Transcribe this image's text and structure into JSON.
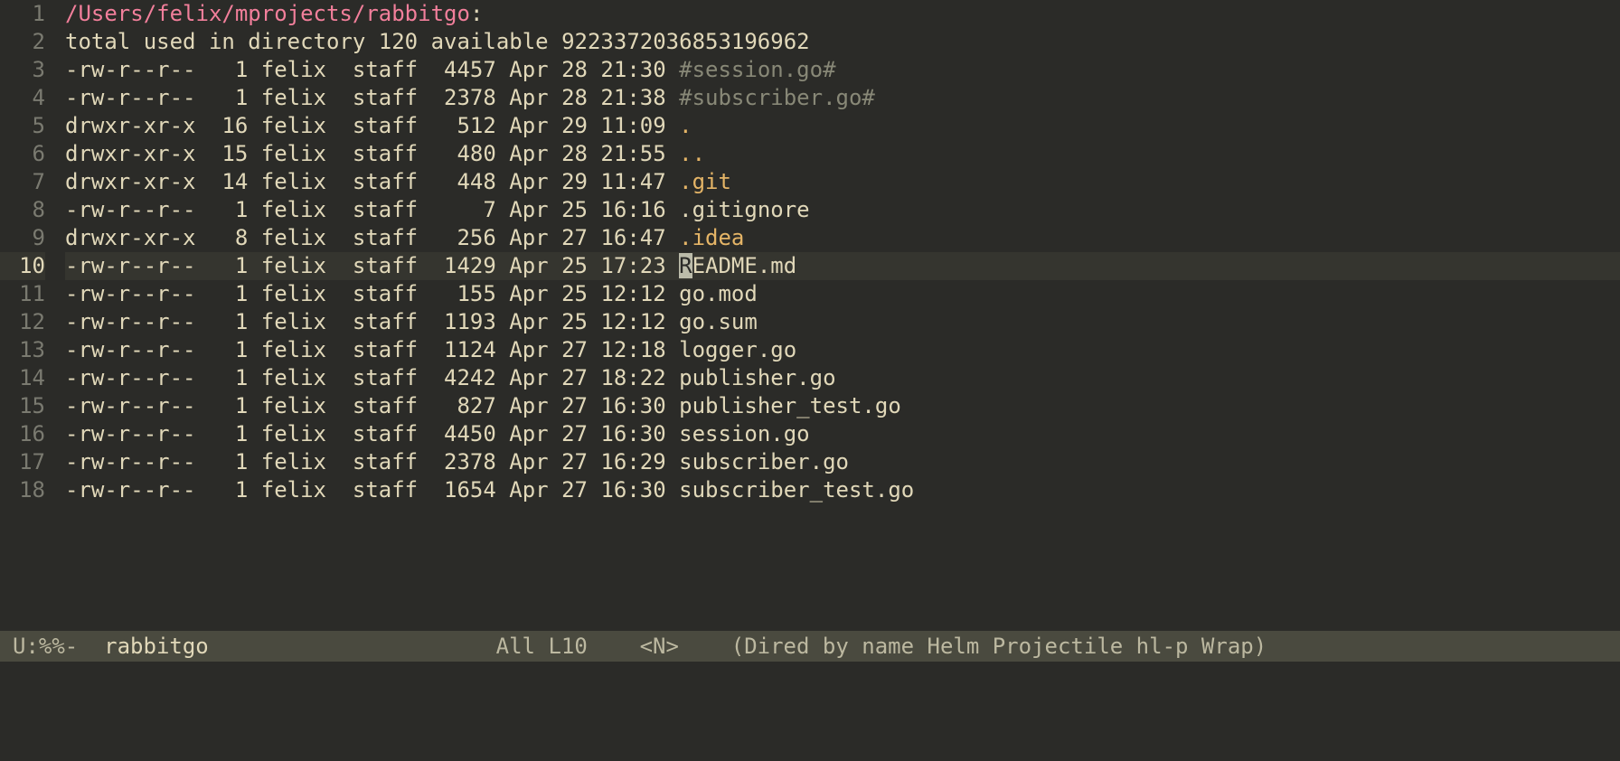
{
  "colors": {
    "bg": "#2b2b28",
    "fg": "#e1d8b9",
    "gutter_fg": "#7a7a70",
    "hl_line_bg": "#35352f",
    "path": "#f27f9b",
    "dir": "#e5b567",
    "dim": "#888877",
    "modeline_bg": "#4a4a3f",
    "modeline_fg": "#bcb8a0",
    "cursor_bg": "#bcbcaa"
  },
  "cursor_line": 10,
  "line_numbers": [
    1,
    2,
    3,
    4,
    5,
    6,
    7,
    8,
    9,
    10,
    11,
    12,
    13,
    14,
    15,
    16,
    17,
    18
  ],
  "header_path": "/Users/felix/mprojects/rabbitgo",
  "header_colon": ":",
  "totals_line": "total used in directory 120 available 9223372036853196962",
  "entries": [
    {
      "perm": "-rw-r--r--",
      "links": "1",
      "user": "felix",
      "group": "staff",
      "size": "4457",
      "date": "Apr 28 21:30",
      "name": "#session.go#",
      "style": "dim"
    },
    {
      "perm": "-rw-r--r--",
      "links": "1",
      "user": "felix",
      "group": "staff",
      "size": "2378",
      "date": "Apr 28 21:38",
      "name": "#subscriber.go#",
      "style": "dim"
    },
    {
      "perm": "drwxr-xr-x",
      "links": "16",
      "user": "felix",
      "group": "staff",
      "size": "512",
      "date": "Apr 29 11:09",
      "name": ".",
      "style": "dir"
    },
    {
      "perm": "drwxr-xr-x",
      "links": "15",
      "user": "felix",
      "group": "staff",
      "size": "480",
      "date": "Apr 28 21:55",
      "name": "..",
      "style": "dir"
    },
    {
      "perm": "drwxr-xr-x",
      "links": "14",
      "user": "felix",
      "group": "staff",
      "size": "448",
      "date": "Apr 29 11:47",
      "name": ".git",
      "style": "dir"
    },
    {
      "perm": "-rw-r--r--",
      "links": "1",
      "user": "felix",
      "group": "staff",
      "size": "7",
      "date": "Apr 25 16:16",
      "name": ".gitignore",
      "style": "plain"
    },
    {
      "perm": "drwxr-xr-x",
      "links": "8",
      "user": "felix",
      "group": "staff",
      "size": "256",
      "date": "Apr 27 16:47",
      "name": ".idea",
      "style": "dir"
    },
    {
      "perm": "-rw-r--r--",
      "links": "1",
      "user": "felix",
      "group": "staff",
      "size": "1429",
      "date": "Apr 25 17:23",
      "name": "README.md",
      "style": "plain",
      "cursor": true
    },
    {
      "perm": "-rw-r--r--",
      "links": "1",
      "user": "felix",
      "group": "staff",
      "size": "155",
      "date": "Apr 25 12:12",
      "name": "go.mod",
      "style": "plain"
    },
    {
      "perm": "-rw-r--r--",
      "links": "1",
      "user": "felix",
      "group": "staff",
      "size": "1193",
      "date": "Apr 25 12:12",
      "name": "go.sum",
      "style": "plain"
    },
    {
      "perm": "-rw-r--r--",
      "links": "1",
      "user": "felix",
      "group": "staff",
      "size": "1124",
      "date": "Apr 27 12:18",
      "name": "logger.go",
      "style": "plain"
    },
    {
      "perm": "-rw-r--r--",
      "links": "1",
      "user": "felix",
      "group": "staff",
      "size": "4242",
      "date": "Apr 27 18:22",
      "name": "publisher.go",
      "style": "plain"
    },
    {
      "perm": "-rw-r--r--",
      "links": "1",
      "user": "felix",
      "group": "staff",
      "size": "827",
      "date": "Apr 27 16:30",
      "name": "publisher_test.go",
      "style": "plain"
    },
    {
      "perm": "-rw-r--r--",
      "links": "1",
      "user": "felix",
      "group": "staff",
      "size": "4450",
      "date": "Apr 27 16:30",
      "name": "session.go",
      "style": "plain"
    },
    {
      "perm": "-rw-r--r--",
      "links": "1",
      "user": "felix",
      "group": "staff",
      "size": "2378",
      "date": "Apr 27 16:29",
      "name": "subscriber.go",
      "style": "plain"
    },
    {
      "perm": "-rw-r--r--",
      "links": "1",
      "user": "felix",
      "group": "staff",
      "size": "1654",
      "date": "Apr 27 16:30",
      "name": "subscriber_test.go",
      "style": "plain"
    }
  ],
  "modeline": {
    "left": "U:%%-",
    "buffer": "rabbitgo",
    "mid": "All L10",
    "evil": "<N>",
    "modes": "(Dired by name Helm Projectile hl-p Wrap)"
  }
}
